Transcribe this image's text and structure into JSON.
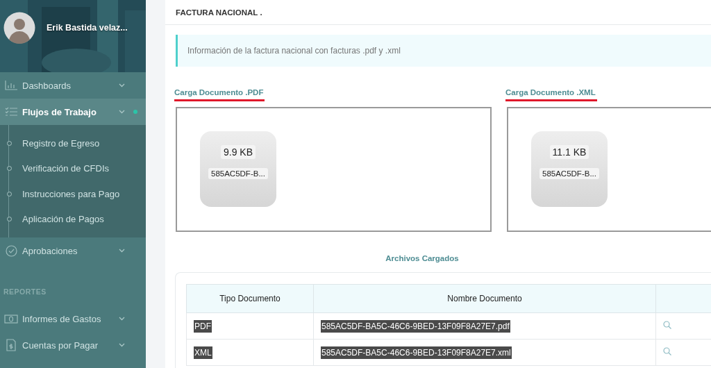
{
  "user": {
    "name": "Erik Bastida velaz..."
  },
  "sidebar": {
    "items": [
      {
        "kind": "item",
        "label": "Dashboards",
        "selected": false
      },
      {
        "kind": "item",
        "label": "Flujos de Trabajo",
        "selected": true,
        "children": [
          {
            "label": "Registro de Egreso"
          },
          {
            "label": "Verificación de CFDIs"
          },
          {
            "label": "Instrucciones para Pago"
          },
          {
            "label": "Aplicación de Pagos"
          }
        ]
      },
      {
        "kind": "item",
        "label": "Aprobaciones",
        "selected": false
      },
      {
        "kind": "section",
        "label": "REPORTES"
      },
      {
        "kind": "item",
        "label": "Informes de Gastos",
        "selected": false
      },
      {
        "kind": "item",
        "label": "Cuentas por Pagar",
        "selected": false
      }
    ]
  },
  "page_title": "FACTURA NACIONAL .",
  "info": "Información de la factura nacional con facturas .pdf y .xml",
  "uploads": [
    {
      "label": "Carga Documento .PDF",
      "file": {
        "size": "9.9 KB",
        "name": "585AC5DF-B..."
      }
    },
    {
      "label": "Carga Documento .XML",
      "file": {
        "size": "11.1 KB",
        "name": "585AC5DF-B..."
      }
    }
  ],
  "files_table": {
    "title": "Archivos Cargados",
    "columns": [
      "Tipo Documento",
      "Nombre Documento"
    ],
    "rows": [
      {
        "type": "PDF",
        "name": "585AC5DF-BA5C-46C6-9BED-13F09F8A27E7.pdf",
        "highlighted": true
      },
      {
        "type": "XML",
        "name": "585AC5DF-BA5C-46C6-9BED-13F09F8A27E7.xml",
        "highlighted": true
      }
    ]
  }
}
